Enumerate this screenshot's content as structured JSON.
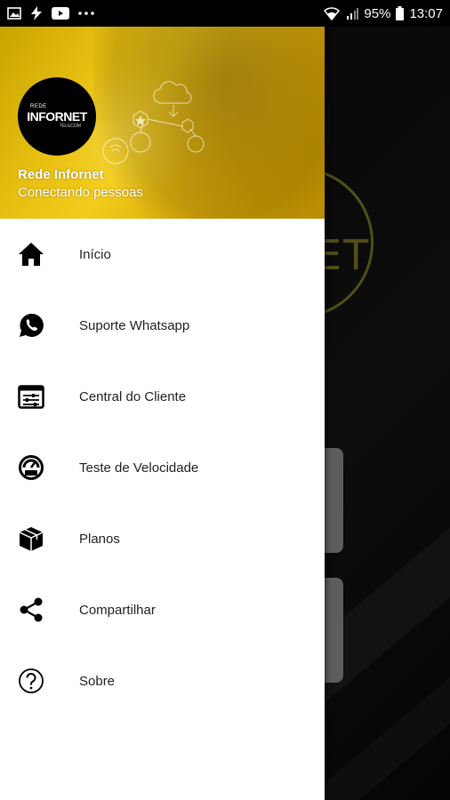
{
  "status_bar": {
    "left_icons": [
      "image-icon",
      "flash-icon",
      "youtube-icon",
      "more-dots-icon"
    ],
    "battery": "95%",
    "time": "13:07"
  },
  "background_app": {
    "logo_fragment": "ET",
    "accent_color": "#7d7a24"
  },
  "drawer": {
    "header": {
      "logo": {
        "top": "REDE",
        "main": "INFORNET",
        "bottom": "TELECOM"
      },
      "title": "Rede Infornet",
      "subtitle": "Conectando pessoas",
      "brand_color": "#f2cc1a"
    },
    "items": [
      {
        "label": "Início",
        "icon": "home-icon"
      },
      {
        "label": "Suporte Whatsapp",
        "icon": "whatsapp-icon"
      },
      {
        "label": "Central do Cliente",
        "icon": "settings-panel-icon"
      },
      {
        "label": "Teste de Velocidade",
        "icon": "speedometer-icon"
      },
      {
        "label": "Planos",
        "icon": "package-icon"
      },
      {
        "label": "Compartilhar",
        "icon": "share-icon"
      },
      {
        "label": "Sobre",
        "icon": "help-icon"
      }
    ]
  }
}
